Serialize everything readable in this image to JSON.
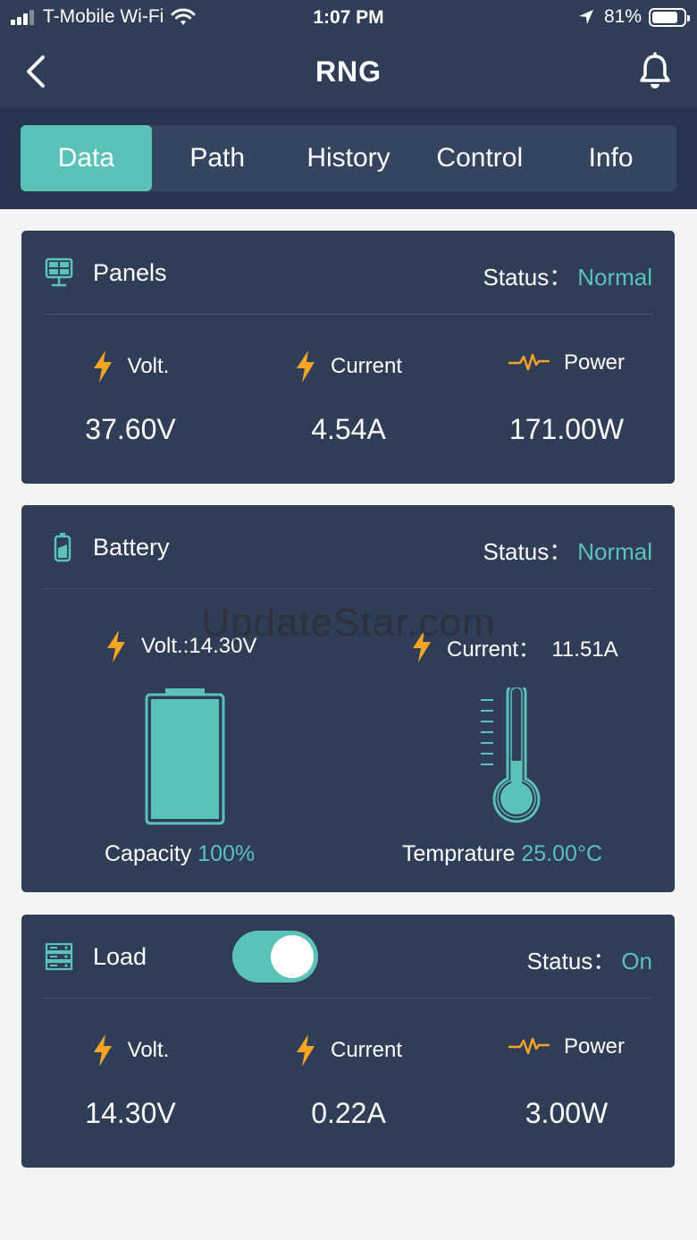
{
  "status_bar": {
    "carrier": "T-Mobile Wi-Fi",
    "time": "1:07 PM",
    "battery_percent": "81%",
    "battery_level": 0.81,
    "icons": [
      "signal-icon",
      "wifi-icon",
      "location-arrow-icon",
      "battery-icon"
    ]
  },
  "nav": {
    "title": "RNG",
    "icons": [
      "back-chevron-icon",
      "bell-icon"
    ]
  },
  "tabs": [
    {
      "label": "Data",
      "active": true
    },
    {
      "label": "Path",
      "active": false
    },
    {
      "label": "History",
      "active": false
    },
    {
      "label": "Control",
      "active": false
    },
    {
      "label": "Info",
      "active": false
    }
  ],
  "panels": {
    "title": "Panels",
    "status_label": "Status：",
    "status_value": "Normal",
    "metrics": [
      {
        "label": "Volt.",
        "value": "37.60V",
        "icon": "lightning-icon"
      },
      {
        "label": "Current",
        "value": "4.54A",
        "icon": "lightning-icon"
      },
      {
        "label": "Power",
        "value": "171.00W",
        "icon": "pulse-icon"
      }
    ]
  },
  "battery": {
    "title": "Battery",
    "status_label": "Status：",
    "status_value": "Normal",
    "volt_text": "Volt.:14.30V",
    "current_text": "Current：  11.51A",
    "capacity_label": "Capacity ",
    "capacity_value": "100%",
    "capacity_level": 1.0,
    "temp_label": "Temprature ",
    "temp_value": "25.00°C"
  },
  "load": {
    "title": "Load",
    "toggle_on": true,
    "status_label": "Status：",
    "status_value": "On",
    "metrics": [
      {
        "label": "Volt.",
        "value": "14.30V",
        "icon": "lightning-icon"
      },
      {
        "label": "Current",
        "value": "0.22A",
        "icon": "lightning-icon"
      },
      {
        "label": "Power",
        "value": "3.00W",
        "icon": "pulse-icon"
      }
    ]
  },
  "watermark": "UpdateStar.com",
  "colors": {
    "header_bg": "#2f3d57",
    "card_bg": "#2f3d57",
    "accent": "#5bc2b8",
    "icon_orange": "#f5a524",
    "page_bg": "#f4f4f4"
  }
}
